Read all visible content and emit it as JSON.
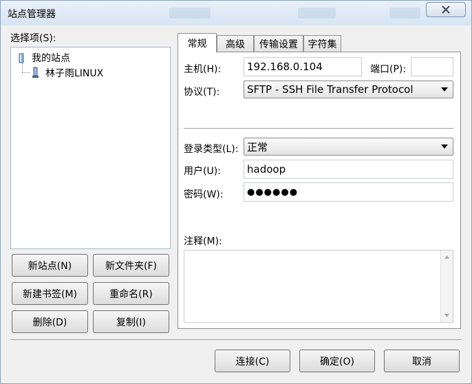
{
  "window": {
    "title": "站点管理器"
  },
  "left": {
    "tree_label": "选择项(S):",
    "tree": {
      "root": "我的站点",
      "children": [
        "林子雨LINUX"
      ]
    },
    "buttons": {
      "new_site": "新站点(N)",
      "new_folder": "新文件夹(F)",
      "new_bookmark": "新建书签(M)",
      "rename": "重命名(R)",
      "delete": "删除(D)",
      "copy": "复制(I)"
    }
  },
  "tabs": [
    "常规",
    "高级",
    "传输设置",
    "字符集"
  ],
  "general": {
    "host_label": "主机(H):",
    "host_value": "192.168.0.104",
    "port_label": "端口(P):",
    "port_value": "",
    "protocol_label": "协议(T):",
    "protocol_value": "SFTP - SSH File Transfer Protocol",
    "logon_type_label": "登录类型(L):",
    "logon_type_value": "正常",
    "user_label": "用户(U):",
    "user_value": "hadoop",
    "password_label": "密码(W):",
    "password_value": "●●●●●●",
    "comments_label": "注释(M):",
    "comments_value": ""
  },
  "footer": {
    "connect": "连接(C)",
    "ok": "确定(O)",
    "cancel": "取消"
  }
}
